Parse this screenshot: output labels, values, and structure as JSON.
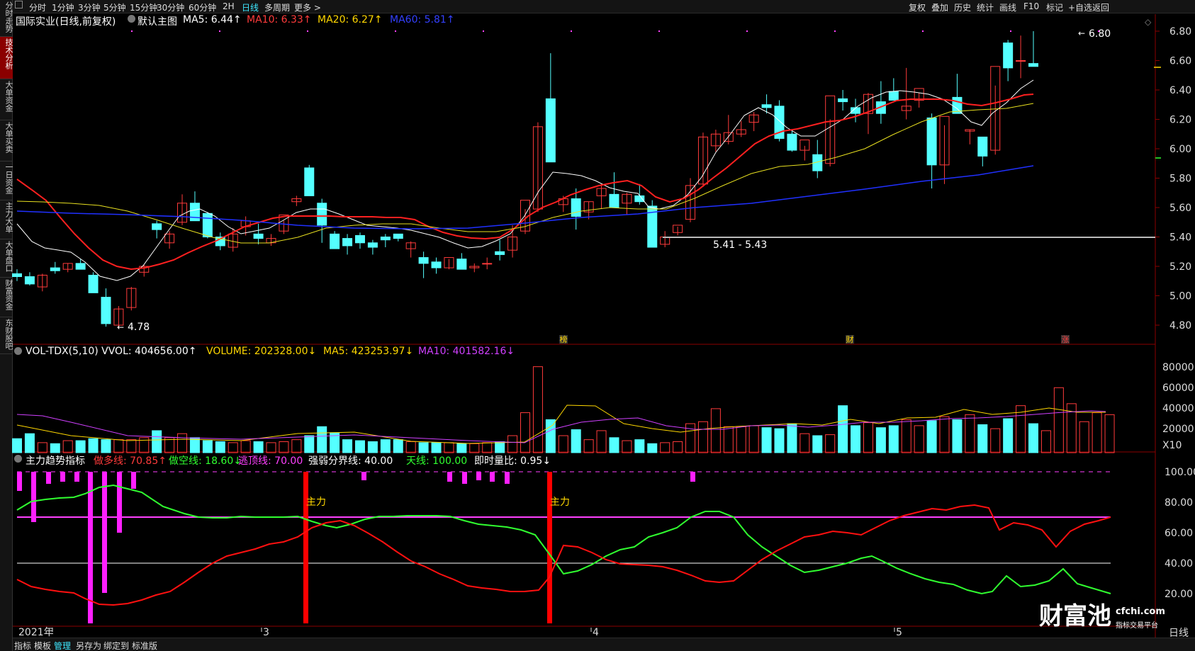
{
  "left_nav": [
    "分时走势",
    "技术分析",
    "大单资金",
    "大单买卖",
    "一日资金",
    "主力大单",
    "大单盘口",
    "财富资金",
    "东财股吧"
  ],
  "left_nav_active": 1,
  "timeframes": [
    "分时",
    "1分钟",
    "3分钟",
    "5分钟",
    "15分钟",
    "30分钟",
    "60分钟",
    "2H",
    "日线",
    "多周期",
    "更多 >"
  ],
  "timeframe_active": 8,
  "toolbar_right": [
    "复权",
    "叠加",
    "历史",
    "统计",
    "画线",
    "F10",
    "标记",
    "+自选",
    "返回"
  ],
  "main_title": "国际实业(日线,前复权)",
  "main_indicator": "默认主图",
  "ma_labels": [
    {
      "text": "MA5: 6.44↑",
      "color": "#ffffff"
    },
    {
      "text": "MA10: 6.33↑",
      "color": "#ff3b3b"
    },
    {
      "text": "MA20: 6.27↑",
      "color": "#ffd700"
    },
    {
      "text": "MA60: 5.81↑",
      "color": "#3340ff"
    }
  ],
  "price_axis": [
    "6.80",
    "6.60",
    "6.40",
    "6.20",
    "6.00",
    "5.80",
    "5.60",
    "5.40",
    "5.20",
    "5.00",
    "4.80"
  ],
  "annotations": {
    "high": "6.80",
    "low": "4.78",
    "range": "5.41 - 5.43"
  },
  "event_markers": [
    "榜",
    "财",
    "涨"
  ],
  "vol_labels": [
    {
      "text": "VOL-TDX(5,10) VVOL: 404656.00↑",
      "color": "#ffffff"
    },
    {
      "text": "VOLUME: 202328.00↓",
      "color": "#ffd700"
    },
    {
      "text": "MA5: 423253.97↓",
      "color": "#ffd700"
    },
    {
      "text": "MA10: 401582.16↓",
      "color": "#d040ff"
    }
  ],
  "vol_axis": [
    "80000",
    "60000",
    "40000",
    "20000",
    "X10"
  ],
  "ind_labels": [
    {
      "text": "主力趋势指标",
      "color": "#ffffff"
    },
    {
      "text": "做多线: 70.85↑",
      "color": "#ff3b3b"
    },
    {
      "text": "做空线: 18.60↓",
      "color": "#30ff30"
    },
    {
      "text": "逃顶线: 70.00",
      "color": "#ff40ff"
    },
    {
      "text": "强弱分界线: 40.00",
      "color": "#ffffff"
    },
    {
      "text": "天线: 100.00",
      "color": "#30ff30"
    },
    {
      "text": "即时量比: 0.95↓",
      "color": "#ffffff"
    }
  ],
  "ind_axis": [
    "100.00",
    "80.00",
    "60.00",
    "40.00",
    "20.00"
  ],
  "zhuli_label": "主力",
  "date_axis": [
    "2021年",
    "3",
    "4",
    "5"
  ],
  "period_label": "日线",
  "bottom_tabs": [
    "指标",
    "模板",
    "管理",
    "另存为",
    "绑定到",
    "标准版"
  ],
  "bottom_active": 2,
  "watermark": {
    "brand": "财富池",
    "domain": "cfchi.com",
    "slogan": "指标交易平台"
  },
  "colors": {
    "up": "#ff3b3b",
    "down": "#54ffff",
    "ma5": "#ffffff",
    "ma10": "#ff2020",
    "ma20": "#e8e020",
    "ma60": "#2030ff"
  },
  "chart_data": {
    "type": "candlestick",
    "title": "国际实业(日线,前复权)",
    "ylim": [
      4.72,
      6.86
    ],
    "ohlc": [
      [
        5.15,
        5.18,
        5.1,
        5.13
      ],
      [
        5.13,
        5.16,
        5.07,
        5.08
      ],
      [
        5.06,
        5.15,
        5.03,
        5.14
      ],
      [
        5.19,
        5.23,
        5.15,
        5.17
      ],
      [
        5.18,
        5.22,
        5.16,
        5.22
      ],
      [
        5.22,
        5.25,
        5.19,
        5.18
      ],
      [
        5.14,
        5.16,
        5.04,
        5.02
      ],
      [
        4.99,
        5.05,
        4.79,
        4.81
      ],
      [
        4.8,
        4.93,
        4.78,
        4.91
      ],
      [
        4.92,
        5.06,
        4.9,
        5.05
      ],
      [
        5.16,
        5.21,
        5.13,
        5.2
      ],
      [
        5.49,
        5.51,
        5.39,
        5.45
      ],
      [
        5.36,
        5.44,
        5.32,
        5.42
      ],
      [
        5.5,
        5.69,
        5.48,
        5.63
      ],
      [
        5.63,
        5.71,
        5.56,
        5.51
      ],
      [
        5.56,
        5.57,
        5.39,
        5.4
      ],
      [
        5.4,
        5.43,
        5.31,
        5.34
      ],
      [
        5.33,
        5.46,
        5.3,
        5.42
      ],
      [
        5.47,
        5.54,
        5.41,
        5.51
      ],
      [
        5.42,
        5.49,
        5.35,
        5.39
      ],
      [
        5.36,
        5.42,
        5.34,
        5.39
      ],
      [
        5.44,
        5.51,
        5.42,
        5.55
      ],
      [
        5.64,
        5.68,
        5.61,
        5.66
      ],
      [
        5.87,
        5.89,
        5.76,
        5.68
      ],
      [
        5.63,
        5.66,
        5.36,
        5.48
      ],
      [
        5.42,
        5.44,
        5.32,
        5.32
      ],
      [
        5.39,
        5.42,
        5.28,
        5.34
      ],
      [
        5.41,
        5.43,
        5.32,
        5.36
      ],
      [
        5.36,
        5.38,
        5.28,
        5.33
      ],
      [
        5.4,
        5.42,
        5.33,
        5.38
      ],
      [
        5.42,
        5.42,
        5.37,
        5.39
      ],
      [
        5.32,
        5.37,
        5.26,
        5.36
      ],
      [
        5.26,
        5.3,
        5.12,
        5.22
      ],
      [
        5.23,
        5.26,
        5.15,
        5.19
      ],
      [
        5.19,
        5.25,
        5.18,
        5.26
      ],
      [
        5.25,
        5.29,
        5.2,
        5.18
      ],
      [
        5.19,
        5.22,
        5.16,
        5.2
      ],
      [
        5.22,
        5.26,
        5.18,
        5.22
      ],
      [
        5.3,
        5.38,
        5.24,
        5.28
      ],
      [
        5.31,
        5.48,
        5.26,
        5.4
      ],
      [
        5.44,
        5.59,
        5.42,
        5.65
      ],
      [
        5.59,
        6.18,
        5.57,
        6.15
      ],
      [
        6.34,
        6.65,
        6.05,
        5.91
      ],
      [
        5.62,
        5.68,
        5.57,
        5.66
      ],
      [
        5.66,
        5.73,
        5.45,
        5.54
      ],
      [
        5.57,
        5.64,
        5.52,
        5.64
      ],
      [
        5.68,
        5.76,
        5.59,
        5.73
      ],
      [
        5.69,
        5.84,
        5.66,
        5.6
      ],
      [
        5.63,
        5.7,
        5.55,
        5.69
      ],
      [
        5.68,
        5.76,
        5.62,
        5.64
      ],
      [
        5.61,
        5.65,
        5.56,
        5.33
      ],
      [
        5.35,
        5.44,
        5.33,
        5.4
      ],
      [
        5.43,
        5.47,
        5.41,
        5.48
      ],
      [
        5.52,
        5.8,
        5.5,
        5.75
      ],
      [
        5.76,
        6.11,
        5.74,
        6.08
      ],
      [
        6.02,
        6.13,
        5.98,
        6.1
      ],
      [
        6.05,
        6.23,
        6.03,
        6.11
      ],
      [
        6.1,
        6.19,
        6.08,
        6.13
      ],
      [
        6.18,
        6.25,
        6.12,
        6.23
      ],
      [
        6.3,
        6.37,
        6.24,
        6.28
      ],
      [
        6.29,
        6.33,
        6.05,
        6.07
      ],
      [
        6.1,
        6.13,
        5.98,
        5.99
      ],
      [
        5.99,
        6.02,
        5.92,
        6.06
      ],
      [
        5.96,
        6.06,
        5.8,
        5.85
      ],
      [
        5.9,
        6.2,
        5.88,
        6.36
      ],
      [
        6.34,
        6.4,
        6.26,
        6.32
      ],
      [
        6.28,
        6.34,
        6.18,
        6.24
      ],
      [
        6.24,
        6.38,
        6.1,
        6.37
      ],
      [
        6.32,
        6.46,
        6.17,
        6.24
      ],
      [
        6.39,
        6.48,
        6.33,
        6.33
      ],
      [
        6.26,
        6.55,
        6.2,
        6.29
      ],
      [
        6.33,
        6.38,
        6.28,
        6.41
      ],
      [
        6.21,
        6.24,
        5.73,
        5.89
      ],
      [
        5.89,
        6.16,
        5.76,
        6.22
      ],
      [
        6.35,
        6.51,
        6.28,
        6.24
      ],
      [
        6.12,
        6.13,
        6.03,
        6.13
      ],
      [
        6.08,
        6.08,
        5.88,
        5.95
      ],
      [
        5.99,
        6.43,
        5.96,
        6.56
      ],
      [
        6.72,
        6.74,
        6.46,
        6.55
      ],
      [
        6.6,
        6.77,
        6.48,
        6.6
      ],
      [
        6.58,
        6.8,
        6.56,
        6.56
      ]
    ],
    "ma_paths": {
      "ma5": [
        [
          24,
          316
        ],
        [
          45,
          341
        ],
        [
          63,
          350
        ],
        [
          82,
          353
        ],
        [
          100,
          356
        ],
        [
          120,
          370
        ],
        [
          141,
          390
        ],
        [
          165,
          396
        ],
        [
          184,
          390
        ],
        [
          202,
          375
        ],
        [
          220,
          350
        ],
        [
          238,
          325
        ],
        [
          253,
          305
        ],
        [
          267,
          298
        ],
        [
          282,
          295
        ],
        [
          303,
          305
        ],
        [
          322,
          320
        ],
        [
          340,
          330
        ],
        [
          360,
          326
        ],
        [
          380,
          322
        ],
        [
          398,
          312
        ],
        [
          418,
          300
        ],
        [
          438,
          295
        ],
        [
          458,
          295
        ],
        [
          478,
          302
        ],
        [
          498,
          310
        ],
        [
          518,
          318
        ],
        [
          540,
          320
        ],
        [
          560,
          322
        ],
        [
          580,
          325
        ],
        [
          600,
          330
        ],
        [
          620,
          335
        ],
        [
          640,
          343
        ],
        [
          660,
          350
        ],
        [
          680,
          348
        ],
        [
          700,
          340
        ],
        [
          720,
          330
        ],
        [
          740,
          305
        ],
        [
          760,
          270
        ],
        [
          780,
          243
        ],
        [
          800,
          245
        ],
        [
          820,
          248
        ],
        [
          840,
          255
        ],
        [
          860,
          265
        ],
        [
          880,
          270
        ],
        [
          900,
          273
        ],
        [
          915,
          292
        ],
        [
          930,
          295
        ],
        [
          950,
          290
        ],
        [
          970,
          275
        ],
        [
          990,
          250
        ],
        [
          1010,
          215
        ],
        [
          1030,
          190
        ],
        [
          1050,
          163
        ],
        [
          1070,
          152
        ],
        [
          1090,
          162
        ],
        [
          1110,
          180
        ],
        [
          1130,
          192
        ],
        [
          1150,
          192
        ],
        [
          1170,
          180
        ],
        [
          1190,
          168
        ],
        [
          1210,
          150
        ],
        [
          1230,
          138
        ],
        [
          1250,
          130
        ],
        [
          1270,
          128
        ],
        [
          1290,
          130
        ],
        [
          1310,
          133
        ],
        [
          1330,
          140
        ],
        [
          1350,
          153
        ],
        [
          1370,
          172
        ],
        [
          1385,
          177
        ],
        [
          1400,
          160
        ],
        [
          1420,
          145
        ],
        [
          1440,
          125
        ],
        [
          1458,
          113
        ]
      ],
      "ma10": [
        [
          24,
          253
        ],
        [
          45,
          268
        ],
        [
          65,
          283
        ],
        [
          85,
          307
        ],
        [
          105,
          330
        ],
        [
          125,
          350
        ],
        [
          145,
          367
        ],
        [
          165,
          376
        ],
        [
          185,
          380
        ],
        [
          205,
          378
        ],
        [
          225,
          373
        ],
        [
          245,
          367
        ],
        [
          265,
          357
        ],
        [
          285,
          348
        ],
        [
          305,
          340
        ],
        [
          325,
          330
        ],
        [
          345,
          320
        ],
        [
          365,
          314
        ],
        [
          385,
          308
        ],
        [
          405,
          305
        ],
        [
          425,
          305
        ],
        [
          445,
          305
        ],
        [
          465,
          305
        ],
        [
          485,
          306
        ],
        [
          505,
          306
        ],
        [
          525,
          306
        ],
        [
          545,
          307
        ],
        [
          565,
          307
        ],
        [
          585,
          310
        ],
        [
          605,
          320
        ],
        [
          625,
          328
        ],
        [
          645,
          333
        ],
        [
          665,
          336
        ],
        [
          685,
          337
        ],
        [
          705,
          335
        ],
        [
          725,
          323
        ],
        [
          745,
          305
        ],
        [
          765,
          293
        ],
        [
          785,
          285
        ],
        [
          805,
          275
        ],
        [
          825,
          268
        ],
        [
          845,
          262
        ],
        [
          865,
          258
        ],
        [
          885,
          255
        ],
        [
          905,
          262
        ],
        [
          925,
          278
        ],
        [
          945,
          285
        ],
        [
          965,
          280
        ],
        [
          985,
          268
        ],
        [
          1005,
          252
        ],
        [
          1025,
          237
        ],
        [
          1045,
          220
        ],
        [
          1065,
          203
        ],
        [
          1085,
          192
        ],
        [
          1105,
          185
        ],
        [
          1125,
          182
        ],
        [
          1145,
          177
        ],
        [
          1165,
          172
        ],
        [
          1185,
          170
        ],
        [
          1205,
          165
        ],
        [
          1225,
          158
        ],
        [
          1245,
          150
        ],
        [
          1265,
          142
        ],
        [
          1285,
          140
        ],
        [
          1305,
          140
        ],
        [
          1325,
          140
        ],
        [
          1345,
          142
        ],
        [
          1365,
          147
        ],
        [
          1385,
          149
        ],
        [
          1405,
          145
        ],
        [
          1425,
          140
        ],
        [
          1445,
          134
        ],
        [
          1458,
          133
        ]
      ],
      "ma20": [
        [
          24,
          284
        ],
        [
          60,
          285
        ],
        [
          100,
          287
        ],
        [
          140,
          290
        ],
        [
          180,
          298
        ],
        [
          220,
          310
        ],
        [
          260,
          323
        ],
        [
          300,
          335
        ],
        [
          340,
          343
        ],
        [
          380,
          343
        ],
        [
          420,
          335
        ],
        [
          460,
          322
        ],
        [
          500,
          318
        ],
        [
          540,
          316
        ],
        [
          580,
          316
        ],
        [
          620,
          322
        ],
        [
          660,
          327
        ],
        [
          700,
          327
        ],
        [
          740,
          320
        ],
        [
          780,
          307
        ],
        [
          820,
          298
        ],
        [
          860,
          293
        ],
        [
          900,
          295
        ],
        [
          940,
          295
        ],
        [
          980,
          280
        ],
        [
          1020,
          262
        ],
        [
          1060,
          245
        ],
        [
          1100,
          235
        ],
        [
          1140,
          232
        ],
        [
          1180,
          222
        ],
        [
          1220,
          210
        ],
        [
          1260,
          190
        ],
        [
          1300,
          172
        ],
        [
          1340,
          158
        ],
        [
          1380,
          155
        ],
        [
          1420,
          153
        ],
        [
          1458,
          146
        ]
      ],
      "ma60": [
        [
          24,
          298
        ],
        [
          100,
          301
        ],
        [
          180,
          303
        ],
        [
          260,
          306
        ],
        [
          340,
          311
        ],
        [
          420,
          318
        ],
        [
          500,
          322
        ],
        [
          580,
          323
        ],
        [
          660,
          322
        ],
        [
          740,
          315
        ],
        [
          820,
          307
        ],
        [
          900,
          302
        ],
        [
          980,
          293
        ],
        [
          1060,
          287
        ],
        [
          1140,
          277
        ],
        [
          1220,
          267
        ],
        [
          1300,
          256
        ],
        [
          1380,
          247
        ],
        [
          1458,
          234
        ]
      ]
    },
    "volume": [
      14,
      19,
      10,
      9,
      12,
      12,
      14,
      13,
      13,
      13,
      15,
      22,
      15,
      19,
      15,
      12,
      11,
      10,
      12,
      11,
      10,
      11,
      13,
      17,
      26,
      20,
      13,
      12,
      11,
      13,
      13,
      11,
      10,
      10,
      10,
      9,
      9,
      10,
      11,
      17,
      40,
      86,
      33,
      17,
      23,
      13,
      22,
      15,
      12,
      13,
      9,
      10,
      11,
      29,
      31,
      44,
      26,
      26,
      27,
      25,
      24,
      29,
      19,
      17,
      18,
      47,
      27,
      30,
      25,
      27,
      33,
      27,
      32,
      36,
      33,
      38,
      28,
      24,
      34,
      47,
      29,
      22,
      65,
      49,
      31,
      40,
      38
    ]
  }
}
